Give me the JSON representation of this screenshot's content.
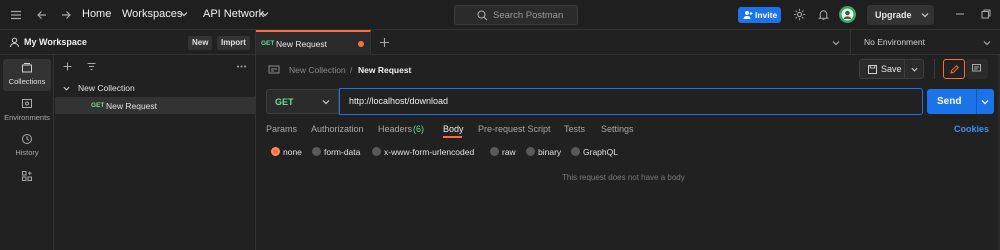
{
  "topbar": {
    "nav": [
      "Home",
      "Workspaces",
      "API Network"
    ],
    "search_placeholder": "Search Postman",
    "invite_label": "Invite",
    "upgrade_label": "Upgrade",
    "icons": [
      "menu-icon",
      "back-arrow-icon",
      "forward-arrow-icon",
      "person-plus-icon",
      "gear-icon",
      "bell-icon",
      "avatar",
      "chevron-down-icon",
      "minimize-icon",
      "restore-icon"
    ]
  },
  "sidebar": {
    "workspace_name": "My Workspace",
    "new_label": "New",
    "import_label": "Import",
    "rail": [
      {
        "label": "Collections",
        "icon": "collections-icon"
      },
      {
        "label": "Environments",
        "icon": "environments-icon"
      },
      {
        "label": "History",
        "icon": "history-icon"
      },
      {
        "label": "",
        "icon": "configure-workbench-icon"
      }
    ],
    "tree": {
      "collection": "New Collection",
      "request_method": "GET",
      "request_name": "New Request"
    }
  },
  "tabs": {
    "active_method": "GET",
    "active_name": "New Request",
    "environment": "No Environment"
  },
  "request": {
    "breadcrumb_parent": "New Collection",
    "breadcrumb_sep": "/",
    "breadcrumb_current": "New Request",
    "save_label": "Save",
    "method": "GET",
    "url": "http://localhost/download",
    "send_label": "Send",
    "subtabs": [
      "Params",
      "Authorization",
      "Headers",
      "Body",
      "Pre-request Script",
      "Tests",
      "Settings"
    ],
    "headers_count": "(6)",
    "active_subtab": "Body",
    "cookies_label": "Cookies",
    "body_types": [
      "none",
      "form-data",
      "x-www-form-urlencoded",
      "raw",
      "binary",
      "GraphQL"
    ],
    "selected_body_type": "none",
    "empty_message": "This request does not have a body"
  },
  "colors": {
    "accent": "#ff6c37",
    "primary": "#1a73e8",
    "get": "#6bdd9a",
    "background": "#212121"
  }
}
